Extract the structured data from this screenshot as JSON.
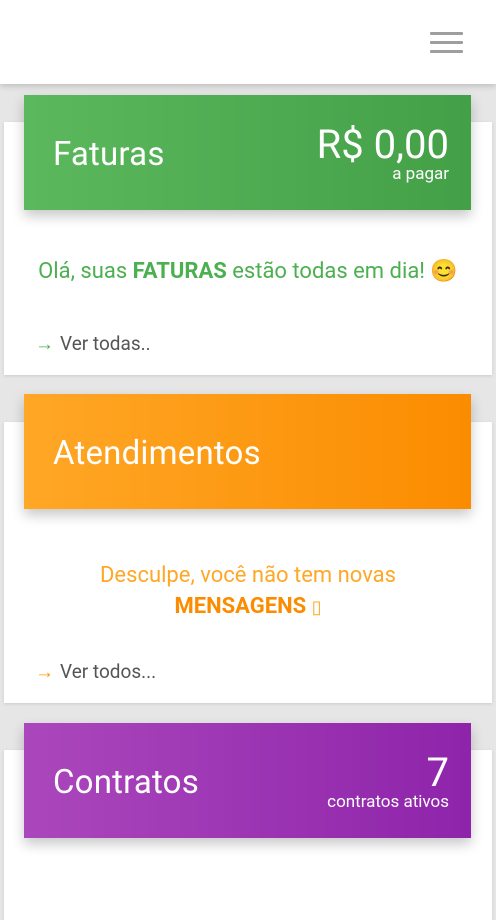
{
  "header": {
    "menu_icon": "hamburger-menu-icon"
  },
  "faturas": {
    "title": "Faturas",
    "amount": "R$ 0,00",
    "amount_caption": "a pagar",
    "message_prefix": "Olá, suas ",
    "message_highlight": "FATURAS",
    "message_suffix": " estão todas em dia! ",
    "message_emoji": "😊",
    "link_label": "Ver todas..",
    "color": "#4caf50"
  },
  "atendimentos": {
    "title": "Atendimentos",
    "message_line1": "Desculpe, você não tem novas",
    "message_highlight": "MENSAGENS",
    "message_symbol": "▯",
    "link_label": "Ver todos...",
    "color": "#ff9800"
  },
  "contratos": {
    "title": "Contratos",
    "count": "7",
    "count_caption": "contratos ativos",
    "color": "#9c27b0"
  }
}
